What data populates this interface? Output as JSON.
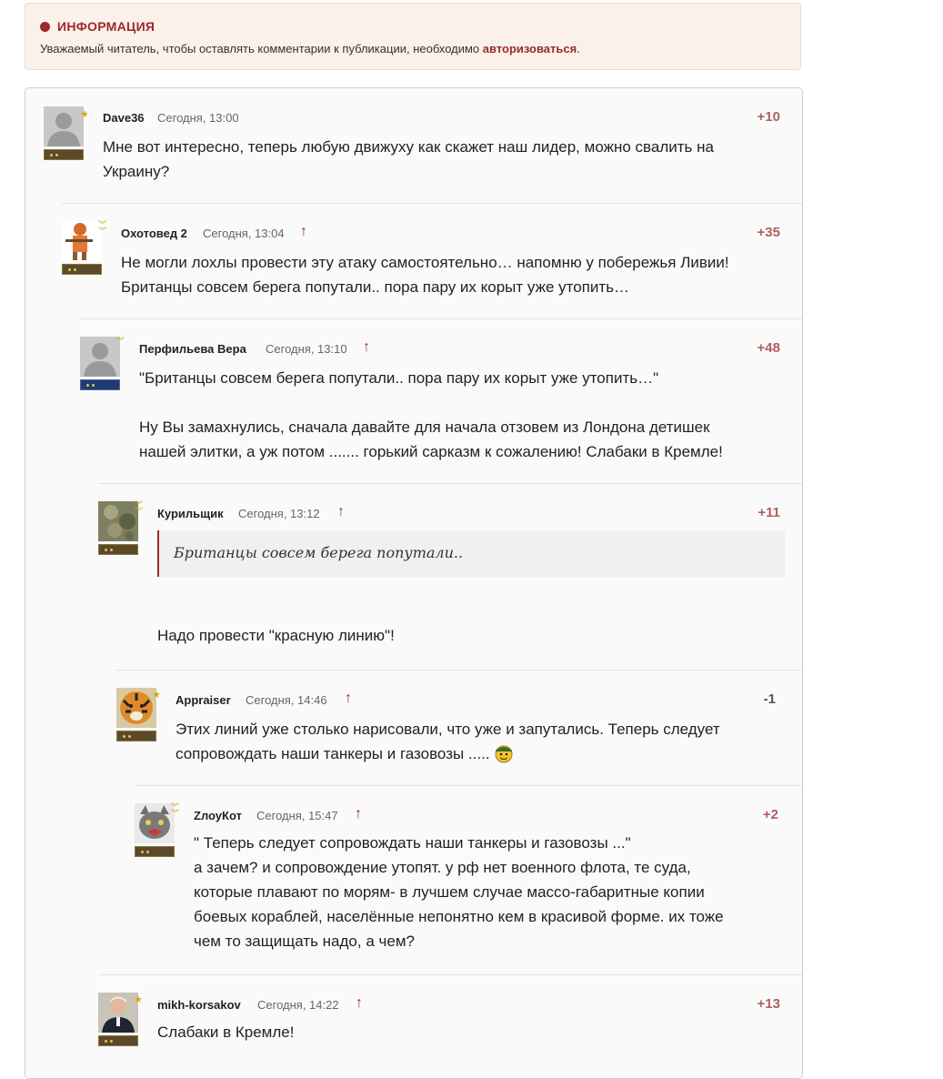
{
  "info": {
    "title": "ИНФОРМАЦИЯ",
    "text_before": "Уважаемый читатель, чтобы оставлять комментарии к публикации, необходимо ",
    "link": "авторизоваться",
    "text_after": "."
  },
  "comments": [
    {
      "author": "Dave36",
      "time": "Сегодня, 13:00",
      "score": "+10",
      "lines": [
        "Мне вот интересно, теперь любую движуху как скажет наш лидер, можно свалить на",
        "Украину?"
      ]
    },
    {
      "author": "Охотовед 2",
      "time": "Сегодня, 13:04",
      "score": "+35",
      "lines": [
        "Не могли лохлы провести эту атаку самостоятельно… напомню у побережья Ливии!",
        "Британцы совсем берега попутали.. пора пару их корыт уже утопить…"
      ]
    },
    {
      "author": "Перфильева Вера",
      "time": "Сегодня, 13:10",
      "score": "+48",
      "lines": [
        "\"Британцы совсем берега попутали.. пора пару их корыт уже утопить…\"",
        "",
        "Ну Вы замахнулись, сначала давайте для начала отзовем из Лондона детишек",
        "нашей элитки, а уж потом ....... горький сарказм к сожалению! Слабаки в Кремле!"
      ]
    },
    {
      "author": "Курильщик",
      "time": "Сегодня, 13:12",
      "score": "+11",
      "quote": "Британцы совсем берега попутали..",
      "lines": [
        "Надо провести \"красную линию\"!"
      ]
    },
    {
      "author": "Appraiser",
      "time": "Сегодня, 14:46",
      "score": "-1",
      "lines": [
        "Этих линий уже столько нарисовали, что уже и запутались. Теперь следует",
        "сопровождать наши танкеры и газовозы ....."
      ]
    },
    {
      "author": "ZлоуКот",
      "time": "Сегодня, 15:47",
      "score": "+2",
      "lines": [
        "\" Теперь следует сопровождать наши танкеры и газовозы ...\"",
        "а зачем? и сопровождение утопят. у рф нет военного флота, те суда,",
        "которые плавают по морям- в лучшем случае массо-габаритные копии",
        "боевых кораблей, населённые непонятно кем в красивой форме. их тоже",
        "чем то защищать надо, а чем?"
      ]
    },
    {
      "author": "mikh-korsakov",
      "time": "Сегодня, 14:22",
      "score": "+13",
      "lines": [
        "Слабаки в Кремле!"
      ]
    }
  ]
}
